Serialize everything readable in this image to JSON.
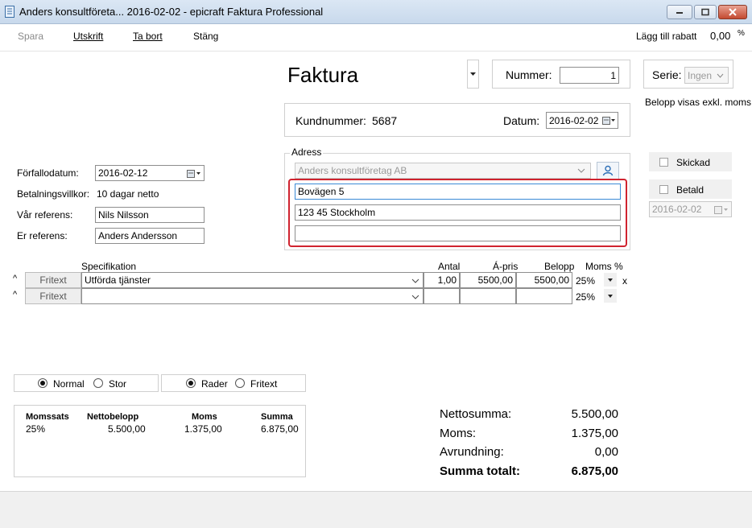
{
  "window": {
    "title": "Anders konsultföreta... 2016-02-02 - epicraft Faktura Professional"
  },
  "toolbar": {
    "spara": "Spara",
    "utskrift": "Utskrift",
    "ta_bort": "Ta bort",
    "stang": "Stäng",
    "rabatt_label": "Lägg till rabatt",
    "rabatt_value": "0,00",
    "rabatt_unit": "%"
  },
  "header": {
    "doc_type": "Faktura",
    "nummer_label": "Nummer:",
    "nummer_value": "1",
    "serie_label": "Serie:",
    "serie_value": "Ingen",
    "belopp_note": "Belopp visas exkl. moms",
    "kundnummer_label": "Kundnummer:",
    "kundnummer_value": "5687",
    "datum_label": "Datum:",
    "datum_value": "2016-02-02"
  },
  "adress": {
    "legend": "Adress",
    "name": "Anders konsultföretag AB",
    "line1": "Bovägen 5",
    "line2": "123 45 Stockholm",
    "line3": ""
  },
  "status": {
    "skickad": "Skickad",
    "betald": "Betald",
    "betald_date": "2016-02-02"
  },
  "details": {
    "forfallodatum_label": "Förfallodatum:",
    "forfallodatum_value": "2016-02-12",
    "betalningsvillkor_label": "Betalningsvillkor:",
    "betalningsvillkor_value": "10 dagar netto",
    "var_referens_label": "Vår referens:",
    "var_referens_value": "Nils Nilsson",
    "er_referens_label": "Er referens:",
    "er_referens_value": "Anders Andersson"
  },
  "rows": {
    "headers": {
      "specifikation": "Specifikation",
      "antal": "Antal",
      "apris": "Á-pris",
      "belopp": "Belopp",
      "moms": "Moms %"
    },
    "row1": {
      "type": "Fritext",
      "spec": "Utförda tjänster",
      "antal": "1,00",
      "apris": "5500,00",
      "belopp": "5500,00",
      "moms": "25%"
    },
    "row2": {
      "type": "Fritext",
      "spec": "",
      "antal": "",
      "apris": "",
      "belopp": "",
      "moms": "25%"
    },
    "delete_mark": "x"
  },
  "view_options": {
    "normal": "Normal",
    "stor": "Stor",
    "rader": "Rader",
    "fritext": "Fritext"
  },
  "vat_table": {
    "headers": [
      "Momssats",
      "Nettobelopp",
      "Moms",
      "Summa"
    ],
    "row": [
      "25%",
      "5.500,00",
      "1.375,00",
      "6.875,00"
    ]
  },
  "totals": {
    "netto_label": "Nettosumma:",
    "netto_value": "5.500,00",
    "moms_label": "Moms:",
    "moms_value": "1.375,00",
    "avrundning_label": "Avrundning:",
    "avrundning_value": "0,00",
    "summa_label": "Summa totalt:",
    "summa_value": "6.875,00"
  },
  "colors": {
    "highlight": "#d0232f",
    "titlebar": "#c8d9ec",
    "focus_border": "#3a8ad6"
  }
}
